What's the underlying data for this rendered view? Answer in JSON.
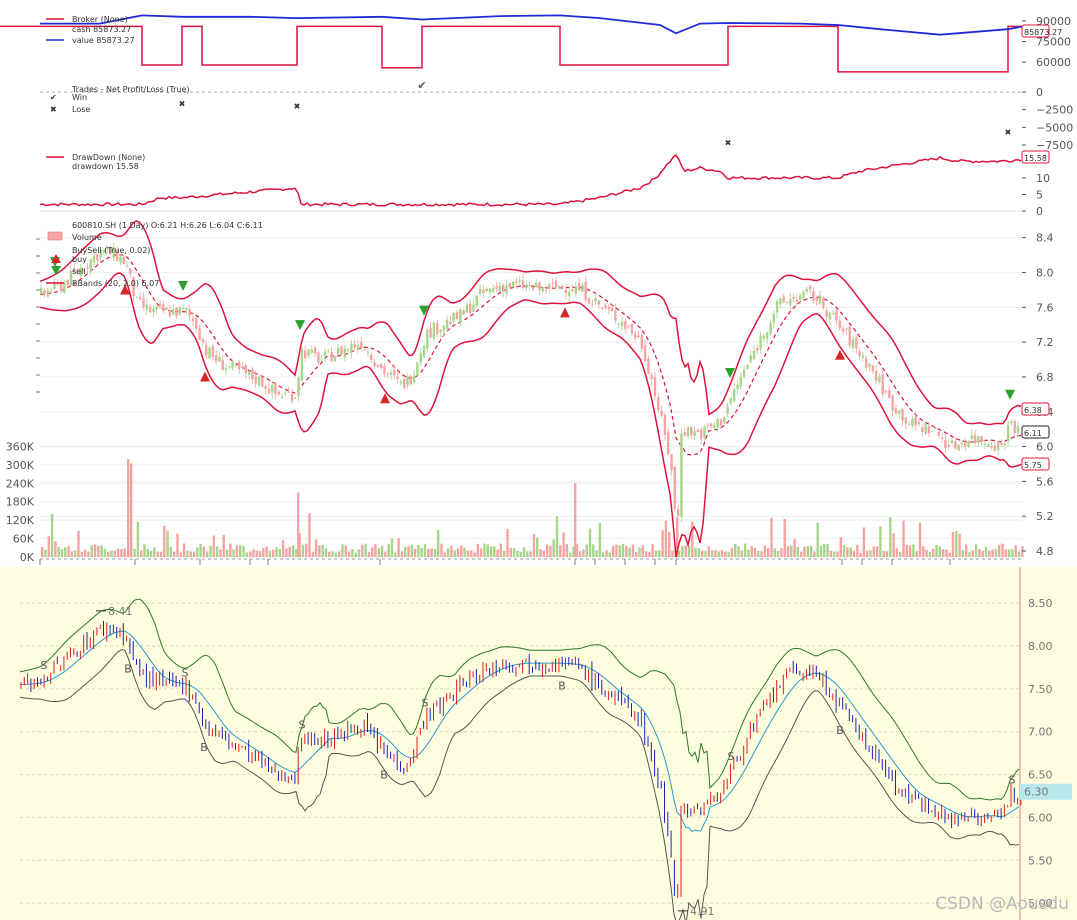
{
  "chart_data": [
    {
      "type": "line",
      "title": "Broker (None)",
      "legend": [
        "Broker (None)",
        "cash 85873.27",
        "value 85873.27"
      ],
      "series": [
        {
          "name": "cash",
          "color": "#dc143c",
          "x": [
            0,
            142,
            142,
            182,
            182,
            202,
            202,
            297,
            297,
            382,
            382,
            422,
            422,
            560,
            560,
            728,
            728,
            838,
            838,
            1008,
            1008,
            1022
          ],
          "y": [
            86000,
            86000,
            58000,
            58000,
            86000,
            86000,
            58000,
            58000,
            86000,
            86000,
            56000,
            56000,
            86000,
            86000,
            58000,
            58000,
            86000,
            86000,
            53000,
            53000,
            86000,
            86000
          ]
        },
        {
          "name": "value",
          "color": "#1f2bd6",
          "x": [
            40,
            100,
            142,
            182,
            250,
            297,
            382,
            422,
            500,
            560,
            600,
            660,
            676,
            700,
            728,
            800,
            838,
            880,
            940,
            1008,
            1022
          ],
          "y": [
            88000,
            88000,
            94000,
            93000,
            93000,
            92000,
            93000,
            91000,
            93500,
            94000,
            92000,
            87000,
            81000,
            88000,
            88500,
            88000,
            87000,
            84000,
            80000,
            84000,
            85873.27
          ]
        }
      ],
      "ylim": [
        50000,
        95000
      ],
      "yticks": [
        60000,
        75000,
        90000
      ],
      "last_value": "85873.27"
    },
    {
      "type": "scatter",
      "title": "Trades - Net Profit/Loss (True)",
      "legend": [
        "Trades - Net Profit/Loss (True)",
        "Win",
        "Lose"
      ],
      "series": [
        {
          "name": "Win",
          "color": "#e05050",
          "x": [
            422
          ],
          "y": [
            1000
          ]
        },
        {
          "name": "Lose",
          "color": "#5b8fc9",
          "x": [
            182,
            297,
            728,
            1008
          ],
          "y": [
            -1500,
            -1800,
            -7000,
            -5500
          ]
        }
      ],
      "ylim": [
        -8500,
        2000
      ],
      "yticks": [
        0,
        -2500,
        -5000,
        -7500
      ]
    },
    {
      "type": "line",
      "title": "DrawDown (None)",
      "legend": [
        "DrawDown (None)",
        "drawdown 15.58"
      ],
      "series": [
        {
          "name": "drawdown",
          "color": "#dc143c",
          "x": [
            40,
            142,
            160,
            182,
            220,
            260,
            297,
            300,
            360,
            382,
            422,
            560,
            600,
            640,
            656,
            664,
            676,
            684,
            700,
            720,
            728,
            800,
            838,
            860,
            900,
            940,
            960,
            1000,
            1022
          ],
          "y": [
            2,
            2,
            4,
            4,
            5,
            6,
            7,
            2,
            2,
            2,
            2,
            2,
            4,
            7,
            10,
            13,
            17,
            12,
            13,
            12,
            10,
            10,
            10,
            12,
            14,
            16,
            15,
            15,
            15.58
          ]
        }
      ],
      "ylim": [
        0,
        19
      ],
      "yticks": [
        0,
        5,
        10
      ],
      "last_value": "15.58"
    },
    {
      "type": "candlestick",
      "title": "600810.SH (1 Day) O:6.21 H:6.26 L:6.04 C:6.11",
      "legend": [
        "600810.SH (1 Day) O:6.21 H:6.26 L:6.04 C:6.11",
        "Volume",
        "BuySell (True, 0.02)",
        "buy",
        "sell",
        "BBands (20, 2.0) 6.07"
      ],
      "close_x": [
        40,
        60,
        80,
        100,
        115,
        125,
        135,
        150,
        170,
        185,
        195,
        205,
        220,
        240,
        260,
        275,
        295,
        300,
        320,
        340,
        360,
        380,
        400,
        410,
        425,
        440,
        460,
        480,
        500,
        520,
        540,
        560,
        580,
        600,
        620,
        640,
        650,
        660,
        670,
        676,
        680,
        700,
        720,
        740,
        760,
        775,
        790,
        810,
        820,
        830,
        850,
        870,
        890,
        910,
        930,
        950,
        970,
        990,
        1000,
        1010,
        1020
      ],
      "close_y": [
        7.75,
        7.85,
        8.05,
        8.25,
        8.2,
        8.1,
        7.65,
        7.55,
        7.55,
        7.55,
        7.4,
        7.1,
        6.95,
        6.85,
        6.75,
        6.6,
        6.6,
        7.1,
        7.0,
        7.1,
        7.2,
        6.9,
        6.7,
        6.8,
        7.3,
        7.4,
        7.5,
        7.75,
        7.85,
        7.85,
        7.8,
        7.85,
        7.8,
        7.6,
        7.45,
        7.2,
        6.8,
        6.3,
        5.8,
        4.91,
        6.2,
        6.15,
        6.3,
        6.8,
        7.25,
        7.6,
        7.7,
        7.75,
        7.65,
        7.5,
        7.2,
        6.9,
        6.5,
        6.25,
        6.2,
        6.0,
        6.1,
        6.05,
        6.0,
        6.3,
        6.11
      ],
      "ylim": [
        4.8,
        8.5
      ],
      "yticks": [
        4.8,
        5.2,
        5.6,
        6.0,
        6.4,
        6.8,
        7.2,
        7.6,
        8.0,
        8.4
      ],
      "bbands_mid": "6.07",
      "bbands_top": "6.38",
      "bbands_bot": "5.75",
      "last_close": "6.11",
      "volume_ticks": [
        "0K",
        "60K",
        "120K",
        "180K",
        "240K",
        "300K",
        "360K"
      ],
      "volume_ylim": [
        0,
        420000
      ],
      "buy_x": [
        125,
        205,
        385,
        565,
        840
      ],
      "sell_x": [
        55,
        183,
        300,
        424,
        730,
        1010
      ],
      "up_color": "#a6d68a",
      "down_color": "#f5a3a3"
    },
    {
      "type": "candlestick",
      "title": "",
      "close_x": [
        20,
        40,
        60,
        80,
        100,
        115,
        125,
        135,
        150,
        170,
        185,
        195,
        205,
        220,
        240,
        260,
        275,
        295,
        300,
        320,
        340,
        360,
        380,
        400,
        410,
        425,
        440,
        460,
        480,
        500,
        520,
        540,
        560,
        580,
        600,
        620,
        640,
        650,
        660,
        670,
        676,
        680,
        700,
        720,
        740,
        760,
        775,
        790,
        810,
        820,
        830,
        850,
        870,
        890,
        910,
        930,
        950,
        970,
        990,
        1000,
        1010,
        1020
      ],
      "close_y": [
        7.55,
        7.6,
        7.8,
        8.0,
        8.2,
        8.2,
        8.1,
        7.75,
        7.6,
        7.55,
        7.55,
        7.35,
        7.05,
        6.95,
        6.8,
        6.65,
        6.5,
        6.5,
        6.95,
        6.9,
        6.95,
        7.1,
        6.8,
        6.6,
        6.7,
        7.2,
        7.3,
        7.55,
        7.7,
        7.8,
        7.8,
        7.8,
        7.8,
        7.75,
        7.5,
        7.35,
        7.15,
        6.7,
        6.3,
        5.6,
        4.91,
        6.1,
        6.1,
        6.3,
        6.8,
        7.2,
        7.5,
        7.7,
        7.7,
        7.6,
        7.45,
        7.1,
        6.8,
        6.45,
        6.2,
        6.15,
        5.95,
        6.05,
        6.0,
        5.95,
        6.3,
        6.3
      ],
      "ylim": [
        4.85,
        8.7
      ],
      "yticks": [
        "5.00",
        "5.50",
        "6.00",
        "6.50",
        "7.00",
        "7.50",
        "8.00",
        "8.50"
      ],
      "high_label": "8.41",
      "low_label": "4.91",
      "last_label": "6.30",
      "buy_x": [
        128,
        204,
        384,
        562,
        840
      ],
      "sell_x": [
        44,
        185,
        302,
        425,
        731,
        1012
      ],
      "buy_label": "B",
      "sell_label": "S",
      "up_color": "#d42020",
      "down_color": "#2020b8"
    }
  ],
  "watermark": "CSDN @Aousdu"
}
